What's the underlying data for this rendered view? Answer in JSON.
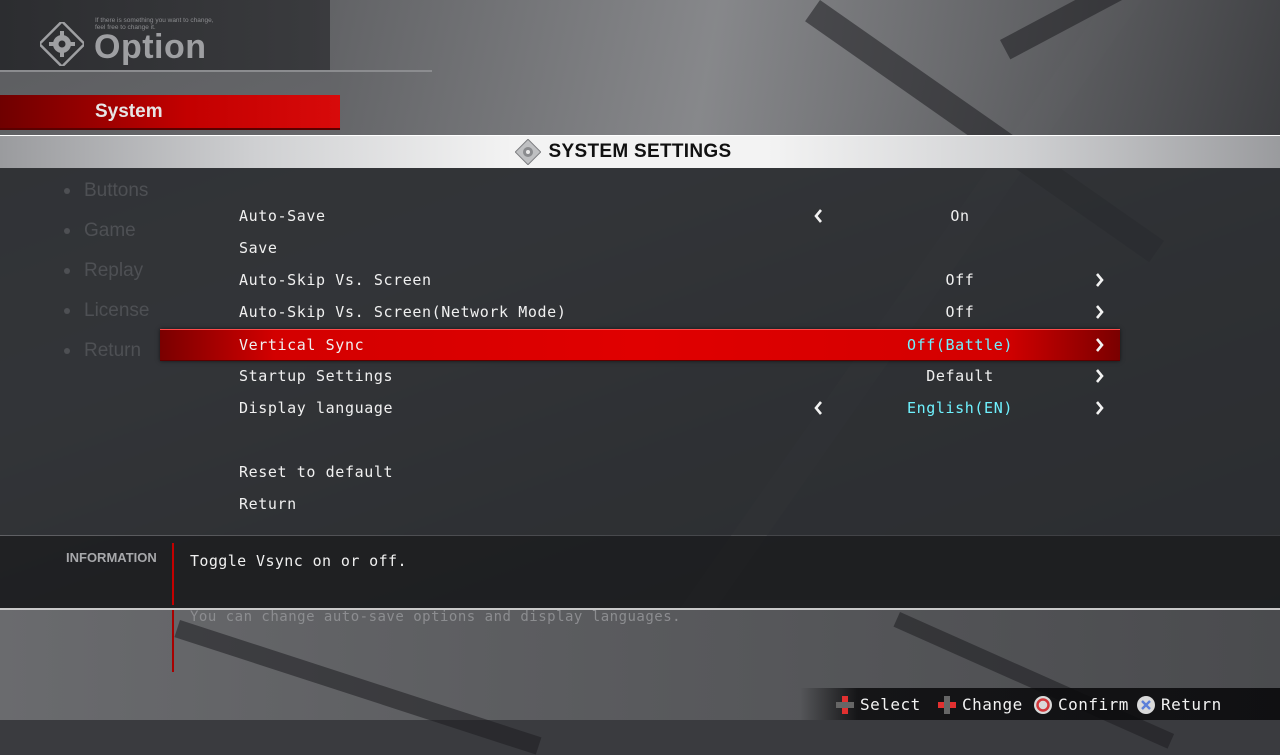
{
  "header": {
    "subtitle_line1": "If there is something you want to change,",
    "subtitle_line2": "feel free to change it.",
    "title": "Option",
    "icon": "gear-icon"
  },
  "active_tab": "System",
  "settings_bar": {
    "title": "SYSTEM SETTINGS",
    "icon": "gear-icon"
  },
  "left_menu": {
    "items": [
      "Buttons",
      "Game",
      "Replay",
      "License",
      "Return"
    ]
  },
  "settings": [
    {
      "label": "Auto-Save",
      "value": "On",
      "value_color": "white",
      "left_arrow": true,
      "right_arrow": false,
      "selected": false
    },
    {
      "label": "Save",
      "value": "",
      "value_color": "white",
      "left_arrow": false,
      "right_arrow": false,
      "selected": false
    },
    {
      "label": "Auto-Skip Vs. Screen",
      "value": "Off",
      "value_color": "white",
      "left_arrow": false,
      "right_arrow": true,
      "selected": false
    },
    {
      "label": "Auto-Skip Vs. Screen(Network Mode)",
      "value": "Off",
      "value_color": "white",
      "left_arrow": false,
      "right_arrow": true,
      "selected": false
    },
    {
      "label": "Vertical Sync",
      "value": "Off(Battle)",
      "value_color": "cyan",
      "left_arrow": false,
      "right_arrow": true,
      "selected": true
    },
    {
      "label": "Startup Settings",
      "value": "Default",
      "value_color": "white",
      "left_arrow": false,
      "right_arrow": true,
      "selected": false
    },
    {
      "label": "Display language",
      "value": "English(EN)",
      "value_color": "cyan",
      "left_arrow": true,
      "right_arrow": true,
      "selected": false
    },
    {
      "label": "Reset to default",
      "value": "",
      "value_color": "white",
      "left_arrow": false,
      "right_arrow": false,
      "selected": false
    },
    {
      "label": "Return",
      "value": "",
      "value_color": "white",
      "left_arrow": false,
      "right_arrow": false,
      "selected": false
    }
  ],
  "info": {
    "label": "INFORMATION",
    "text": "Toggle Vsync on or off.",
    "background_text": "You can change auto-save options and display languages."
  },
  "hints": [
    {
      "icon": "dpad-updown-icon",
      "label": "Select"
    },
    {
      "icon": "dpad-leftright-icon",
      "label": "Change"
    },
    {
      "icon": "circle-button-icon",
      "label": "Confirm"
    },
    {
      "icon": "cross-button-icon",
      "label": "Return"
    }
  ],
  "colors": {
    "accent_red": "#d80000",
    "value_cyan": "#6ff2ff"
  }
}
